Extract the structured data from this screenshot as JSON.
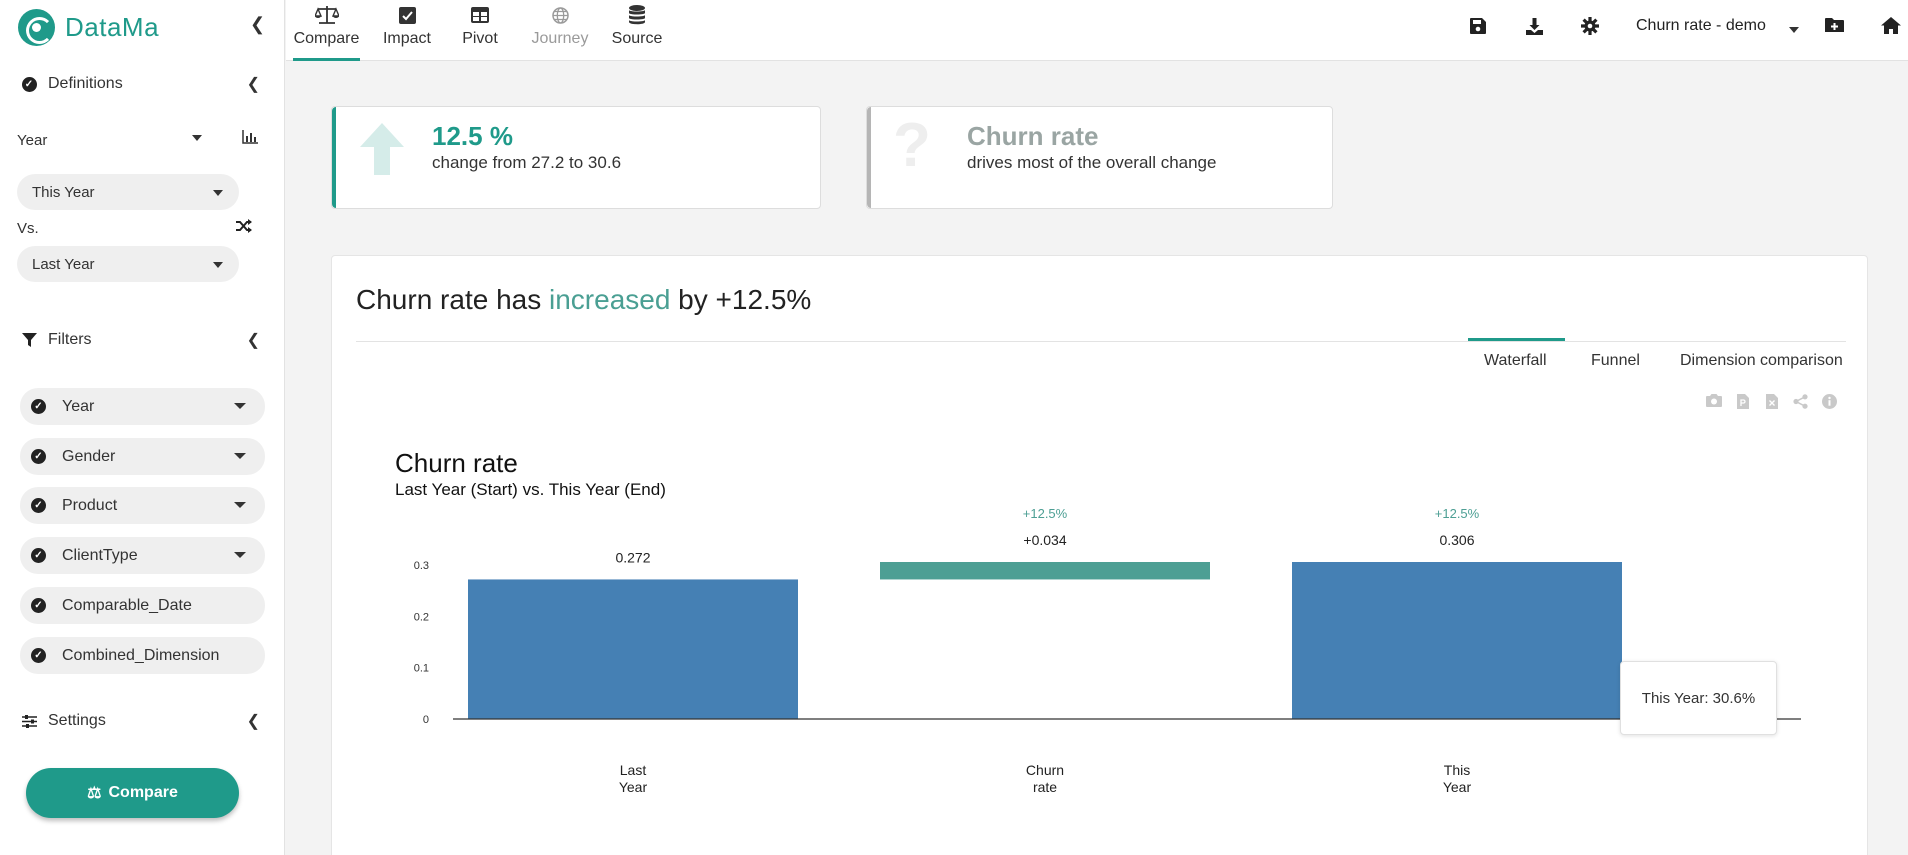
{
  "app": {
    "brand": "DataMa"
  },
  "sidebar": {
    "definitions_label": "Definitions",
    "dimension_label": "Year",
    "this_period": "This Year",
    "vs_label": "Vs.",
    "last_period": "Last Year",
    "filters_label": "Filters",
    "filters": [
      "Year",
      "Gender",
      "Product",
      "ClientType",
      "Comparable_Date",
      "Combined_Dimension"
    ],
    "settings_label": "Settings",
    "compare_button": "Compare"
  },
  "topbar": {
    "tabs": [
      {
        "label": "Compare",
        "icon": "balance-scale-icon"
      },
      {
        "label": "Impact",
        "icon": "checkbox-icon"
      },
      {
        "label": "Pivot",
        "icon": "table-icon"
      },
      {
        "label": "Journey",
        "icon": "globe-icon"
      },
      {
        "label": "Source",
        "icon": "database-icon"
      }
    ],
    "project_name": "Churn rate - demo"
  },
  "kpis": [
    {
      "big": "12.5 %",
      "small": "change from 27.2 to 30.6",
      "icon": "arrow-up-icon",
      "color": "#1f9a8a"
    },
    {
      "big": "Churn rate",
      "small": "drives most of the overall change",
      "icon": "question-icon",
      "color": "#9aa5a3"
    }
  ],
  "main": {
    "headline_prefix": "Churn rate has ",
    "headline_highlight": "increased",
    "headline_suffix": " by +12.5%",
    "view_tabs": [
      "Waterfall",
      "Funnel",
      "Dimension comparison"
    ],
    "active_view": "Waterfall",
    "tooltip": "This Year: 30.6%"
  },
  "chart_data": {
    "type": "bar",
    "subtype": "waterfall",
    "title": "Churn rate",
    "subtitle": "Last Year (Start) vs. This Year (End)",
    "categories": [
      [
        "Last",
        "Year"
      ],
      [
        "Churn",
        "rate"
      ],
      [
        "This",
        "Year"
      ]
    ],
    "values": [
      0.272,
      0.034,
      0.306
    ],
    "bar_kinds": [
      "total",
      "delta",
      "total"
    ],
    "value_labels": [
      "0.272",
      "+0.034",
      "0.306"
    ],
    "pct_labels": [
      "",
      "+12.5%",
      "+12.5%"
    ],
    "yticks": [
      0,
      0.1,
      0.2,
      0.3
    ],
    "ytick_labels": [
      "0",
      "0.1",
      "0.2",
      "0.3"
    ],
    "ylim": [
      0,
      0.306
    ],
    "colors": {
      "total": "#4580b4",
      "delta": "#4d9f94",
      "pct": "#4d9f94"
    }
  },
  "colors": {
    "accent": "#1f9a8a",
    "bar": "#4580b4",
    "delta": "#4d9f94"
  }
}
